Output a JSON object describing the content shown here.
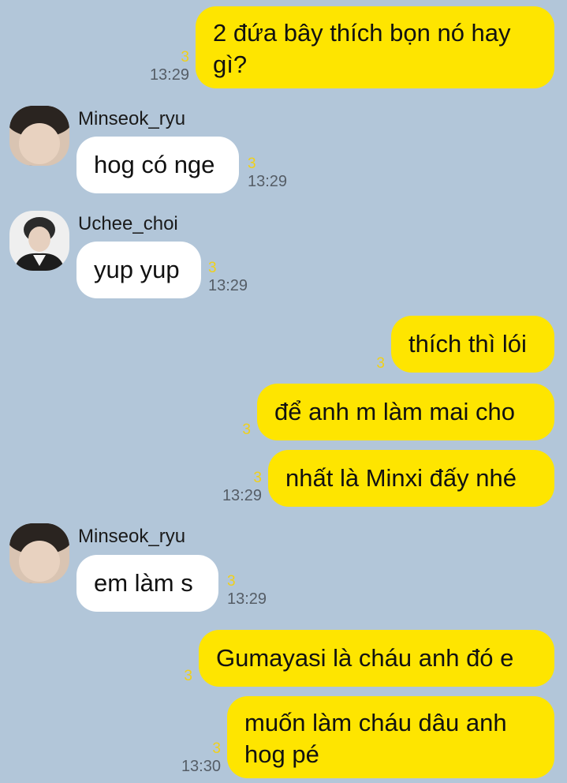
{
  "messages": [
    {
      "id": "m1",
      "text_lines": [
        "2 đứa bây thích bọn nó hay",
        "gì?"
      ],
      "unread": "3",
      "time": "13:29"
    },
    {
      "id": "m2",
      "sender": "Minseok_ryu",
      "text": "hog có nge",
      "unread": "3",
      "time": "13:29"
    },
    {
      "id": "m3",
      "sender": "Uchee_choi",
      "text": "yup yup",
      "unread": "3",
      "time": "13:29"
    },
    {
      "id": "m4",
      "text": "thích thì lói",
      "unread": "3"
    },
    {
      "id": "m5",
      "text": "để anh m làm mai cho",
      "unread": "3"
    },
    {
      "id": "m6",
      "text": "nhất là Minxi đấy nhé",
      "unread": "3",
      "time": "13:29"
    },
    {
      "id": "m7",
      "sender": "Minseok_ryu",
      "text": "em làm s",
      "unread": "3",
      "time": "13:29"
    },
    {
      "id": "m8",
      "text": "Gumayasi là cháu anh đó e",
      "unread": "3"
    },
    {
      "id": "m9",
      "text_lines": [
        "muốn làm cháu dâu anh",
        "hog pé"
      ],
      "unread": "3",
      "time": "13:30"
    }
  ]
}
